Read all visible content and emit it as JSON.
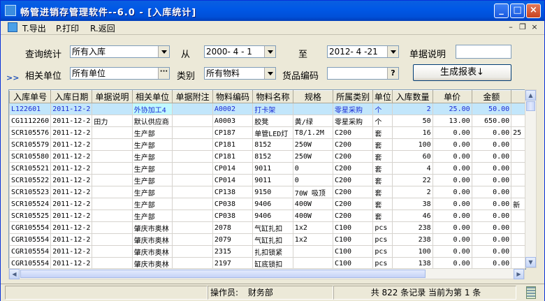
{
  "window": {
    "title": "畅管进销存管理软件--6.0 - [入库统计]"
  },
  "menu": [
    {
      "key": "T",
      "label": "T.导出"
    },
    {
      "key": "P",
      "label": "P.打印"
    },
    {
      "key": "R",
      "label": "R.返回"
    }
  ],
  "filters": {
    "query_label": "查询统计",
    "query_value": "所有入库",
    "from_label": "从",
    "from_value": "2000- 4 - 1",
    "to_label": "至",
    "to_value": "2012- 4 -21",
    "note_label": "单据说明",
    "note_value": "",
    "unit_label": "相关单位",
    "unit_value": "所有单位",
    "category_label": "类别",
    "category_value": "所有物料",
    "code_label": "货品编码",
    "code_value": "",
    "generate_button": "生成报表↓",
    "expander": ">>"
  },
  "table": {
    "columns": [
      "入库单号",
      "入库日期",
      "单据说明",
      "相关单位",
      "单据附注",
      "物料编码",
      "物料名称",
      "规格",
      "所属类别",
      "单位",
      "入库数量",
      "单价",
      "金额",
      ""
    ],
    "rows": [
      [
        "L122601",
        "2011-12-2",
        "",
        "外协加工4",
        "",
        "A0002",
        "打卡架",
        "",
        "零星采购",
        "个",
        "2",
        "25.00",
        "50.00",
        ""
      ],
      [
        "CG1112260",
        "2011-12-2",
        "田力",
        "默认供应商",
        "",
        "A0003",
        "胶凳",
        "黄/绿",
        "零星采购",
        "个",
        "50",
        "13.00",
        "650.00",
        ""
      ],
      [
        "SCR105576",
        "2011-12-2",
        "",
        "生产部",
        "",
        "CP187",
        "单管LED灯",
        "T8/1.2M",
        "C200",
        "套",
        "16",
        "0.00",
        "0.00",
        "25"
      ],
      [
        "SCR105579",
        "2011-12-2",
        "",
        "生产部",
        "",
        "CP181",
        "8152",
        "250W",
        "C200",
        "套",
        "100",
        "0.00",
        "0.00",
        ""
      ],
      [
        "SCR105580",
        "2011-12-2",
        "",
        "生产部",
        "",
        "CP181",
        "8152",
        "250W",
        "C200",
        "套",
        "60",
        "0.00",
        "0.00",
        ""
      ],
      [
        "SCR105521",
        "2011-12-2",
        "",
        "生产部",
        "",
        "CP014",
        "9011",
        "0",
        "C200",
        "套",
        "4",
        "0.00",
        "0.00",
        ""
      ],
      [
        "SCR105522",
        "2011-12-2",
        "",
        "生产部",
        "",
        "CP014",
        "9011",
        "0",
        "C200",
        "套",
        "22",
        "0.00",
        "0.00",
        ""
      ],
      [
        "SCR105523",
        "2011-12-2",
        "",
        "生产部",
        "",
        "CP138",
        "9150",
        "70W 吸顶",
        "C200",
        "套",
        "2",
        "0.00",
        "0.00",
        ""
      ],
      [
        "SCR105524",
        "2011-12-2",
        "",
        "生产部",
        "",
        "CP038",
        "9406",
        "400W",
        "C200",
        "套",
        "38",
        "0.00",
        "0.00",
        "新"
      ],
      [
        "SCR105525",
        "2011-12-2",
        "",
        "生产部",
        "",
        "CP038",
        "9406",
        "400W",
        "C200",
        "套",
        "46",
        "0.00",
        "0.00",
        ""
      ],
      [
        "CGR105554",
        "2011-12-2",
        "",
        "肇庆市奥林",
        "",
        "2078",
        "气缸扎扣",
        "1x2",
        "C100",
        "pcs",
        "238",
        "0.00",
        "0.00",
        ""
      ],
      [
        "CGR105554",
        "2011-12-2",
        "",
        "肇庆市奥林",
        "",
        "2079",
        "气缸扎扣",
        "1x2",
        "C100",
        "pcs",
        "238",
        "0.00",
        "0.00",
        ""
      ],
      [
        "CGR105554",
        "2011-12-2",
        "",
        "肇庆市奥林",
        "",
        "2315",
        "扎扣锁紧",
        "",
        "C100",
        "pcs",
        "100",
        "0.00",
        "0.00",
        ""
      ],
      [
        "CGR105554",
        "2011-12-2",
        "",
        "肇庆市奥林",
        "",
        "2197",
        "缸底锁扣",
        "",
        "C100",
        "pcs",
        "138",
        "0.00",
        "0.00",
        ""
      ]
    ]
  },
  "status": {
    "operator_label": "操作员:",
    "operator_value": "财务部",
    "records": "共 822 条记录 当前为第 1 条"
  }
}
